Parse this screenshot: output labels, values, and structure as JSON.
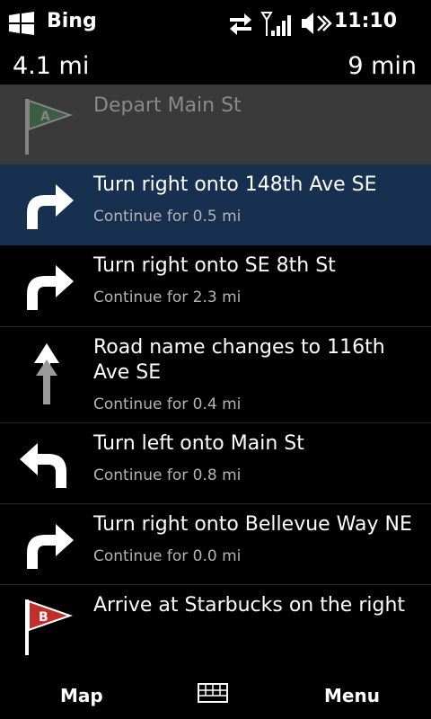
{
  "status": {
    "app_name": "Bing",
    "time": "11:10"
  },
  "summary": {
    "distance": "4.1 mi",
    "duration": "9 min"
  },
  "steps": [
    {
      "instruction": "Depart Main St",
      "detail": "",
      "icon": "flag-a-icon"
    },
    {
      "instruction": "Turn right onto 148th Ave SE",
      "detail": "Continue for 0.5 mi",
      "icon": "turn-right-arrow-icon"
    },
    {
      "instruction": "Turn right onto SE 8th St",
      "detail": "Continue for 2.3 mi",
      "icon": "turn-right-arrow-icon"
    },
    {
      "instruction": "Road name changes to 116th Ave SE",
      "detail": "Continue for 0.4 mi",
      "icon": "straight-arrow-icon"
    },
    {
      "instruction": "Turn left onto Main St",
      "detail": "Continue for 0.8 mi",
      "icon": "turn-left-arrow-icon"
    },
    {
      "instruction": "Turn right onto Bellevue Way NE",
      "detail": "Continue for 0.0 mi",
      "icon": "turn-right-arrow-icon"
    },
    {
      "instruction": "Arrive at Starbucks on the right",
      "detail": "",
      "icon": "flag-b-icon"
    }
  ],
  "flags": {
    "start": "A",
    "end": "B"
  },
  "appbar": {
    "left": "Map",
    "right": "Menu",
    "center_icon": "keyboard-icon"
  },
  "colors": {
    "active_row": "#17304f",
    "faded_row": "#3a3a3a",
    "flag_start": "#3f8a48",
    "flag_end": "#c0302a"
  }
}
